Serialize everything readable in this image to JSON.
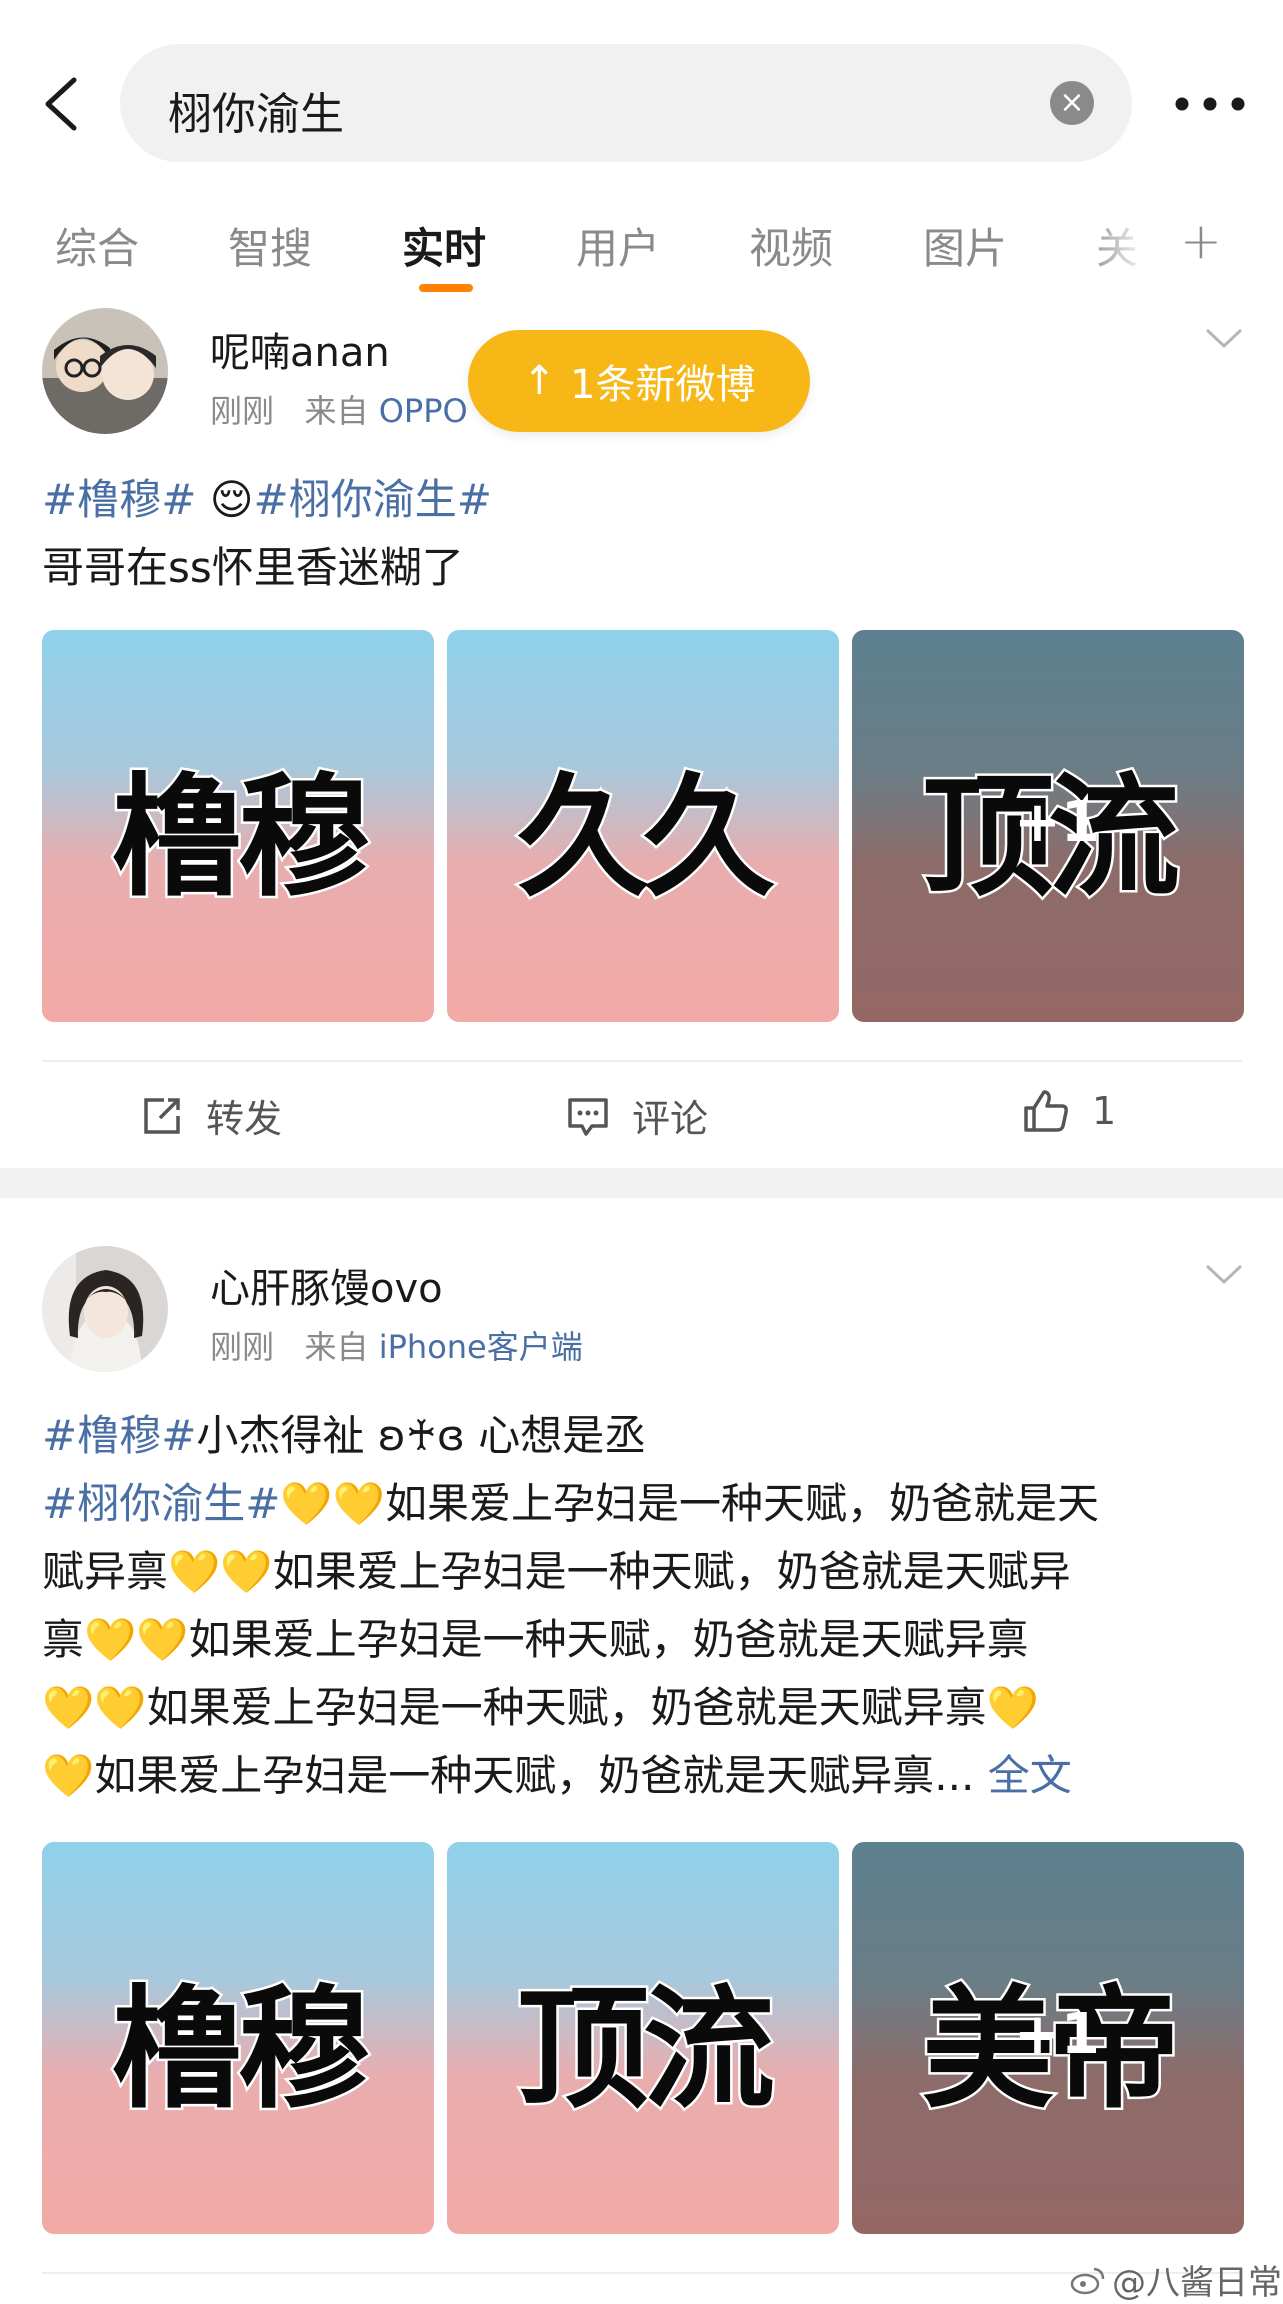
{
  "header": {
    "search_query": "栩你渝生",
    "clear_glyph": "×"
  },
  "tabs": [
    {
      "label": "综合"
    },
    {
      "label": "智搜"
    },
    {
      "label": "实时"
    },
    {
      "label": "用户"
    },
    {
      "label": "视频"
    },
    {
      "label": "图片"
    },
    {
      "label": "关"
    }
  ],
  "tab_plus": "+",
  "new_posts_pill": {
    "arrow": "↑",
    "label": "1条新微博"
  },
  "posts": [
    {
      "username": "呢喃anan",
      "time": "刚刚",
      "from_prefix": "来自",
      "source": "OPPO",
      "tag1": "#橹穆#",
      "emoji": "😌",
      "tag2": "#栩你渝生#",
      "line2": "哥哥在ss怀里香迷糊了",
      "images": [
        "橹穆",
        "久久",
        "顶流"
      ],
      "more_images": "+1",
      "actions": {
        "repost": "转发",
        "comment": "评论",
        "like_count": "1"
      }
    },
    {
      "username": "心肝豚馒ovo",
      "time": "刚刚",
      "from_prefix": "来自",
      "source": "iPhone客户端",
      "tag1": "#橹穆#",
      "line1_rest": "小杰得祉 ʚ♰ɞ 心想是丞",
      "tag2": "#栩你渝生#",
      "hearts": "💛💛",
      "phrase": "如果爱上孕妇是一种天赋，奶爸就是天赋异禀",
      "body_line1": "如果爱上孕妇是一种天赋，奶爸就是天",
      "body_line2": "赋异禀",
      "body_line2b": "如果爱上孕妇是一种天赋，奶爸就是天赋异",
      "body_line3": "禀",
      "body_line3b": "如果爱上孕妇是一种天赋，奶爸就是天赋异禀",
      "body_line4": "如果爱上孕妇是一种天赋，奶爸就是天赋异禀",
      "body_line5": "如果爱上孕妇是一种天赋，奶爸就是天赋异禀...",
      "full_text_link": "全文",
      "images": [
        "橹穆",
        "顶流",
        "美帝"
      ],
      "more_images": "+1"
    }
  ],
  "watermark": "@八酱日常",
  "colors": {
    "accent": "#ff8200",
    "link": "#4a6fa5",
    "pill": "#f7b817"
  }
}
